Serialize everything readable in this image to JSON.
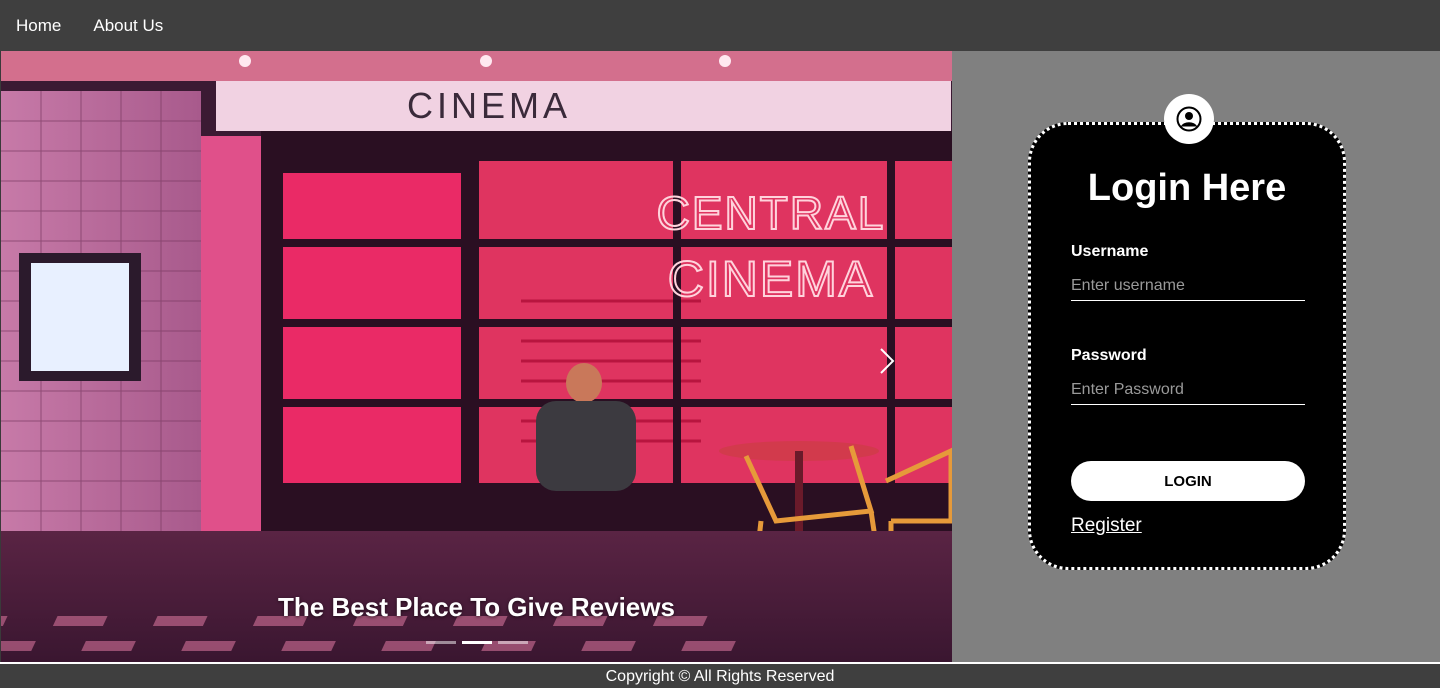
{
  "nav": {
    "items": [
      {
        "label": "Home"
      },
      {
        "label": "About Us"
      }
    ]
  },
  "carousel": {
    "caption": "The Best Place To Give Reviews",
    "slide_count": 3,
    "active_index": 1,
    "sign_top": "CINEMA",
    "neon_line1": "CENTRAL",
    "neon_line2": "CINEMA"
  },
  "login": {
    "title": "Login Here",
    "username_label": "Username",
    "username_placeholder": "Enter username",
    "password_label": "Password",
    "password_placeholder": "Enter Password",
    "login_button": "LOGIN",
    "register_link": "Register",
    "avatar_icon": "user-circle-icon"
  },
  "footer": {
    "text": "Copyright © All Rights Reserved"
  },
  "colors": {
    "navbar": "#3f3f3f",
    "panel": "#808080",
    "card": "#000000",
    "neon": "#ff3b6b"
  }
}
